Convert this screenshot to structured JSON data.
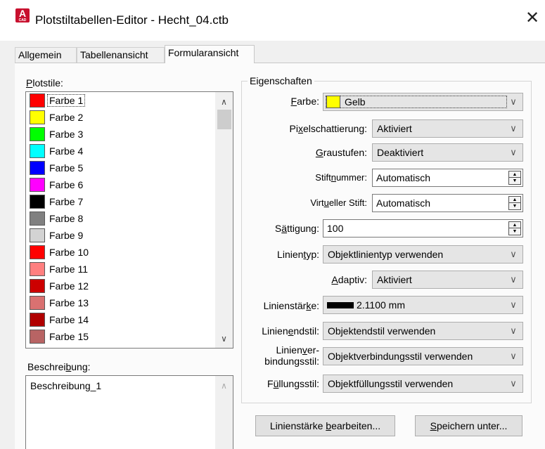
{
  "window": {
    "title": "Plotstiltabellen-Editor - Hecht_04.ctb",
    "app_icon_letter": "A",
    "app_icon_sub": "CAD",
    "close_glyph": "✕"
  },
  "tabs": [
    {
      "label": "Allgemein",
      "active": false
    },
    {
      "label": "Tabellenansicht",
      "active": false
    },
    {
      "label": "Formularansicht",
      "active": true
    }
  ],
  "plotstile": {
    "label_u": "P",
    "label_rest": "lotstile:",
    "items": [
      {
        "label": "Farbe 1",
        "color": "#ff0000",
        "selected": true
      },
      {
        "label": "Farbe 2",
        "color": "#ffff00"
      },
      {
        "label": "Farbe 3",
        "color": "#00ff00"
      },
      {
        "label": "Farbe 4",
        "color": "#00ffff"
      },
      {
        "label": "Farbe 5",
        "color": "#0000ff"
      },
      {
        "label": "Farbe 6",
        "color": "#ff00ff"
      },
      {
        "label": "Farbe 7",
        "color": "#000000"
      },
      {
        "label": "Farbe 8",
        "color": "#808080"
      },
      {
        "label": "Farbe 9",
        "color": "#d3d3d3"
      },
      {
        "label": "Farbe 10",
        "color": "#ff0000"
      },
      {
        "label": "Farbe 11",
        "color": "#ff7f7f"
      },
      {
        "label": "Farbe 12",
        "color": "#cc0000"
      },
      {
        "label": "Farbe 13",
        "color": "#d97171"
      },
      {
        "label": "Farbe 14",
        "color": "#b00000"
      },
      {
        "label": "Farbe 15",
        "color": "#b86464"
      }
    ]
  },
  "beschreibung": {
    "label_a": "Beschrei",
    "label_u": "b",
    "label_b": "ung:",
    "value": "Beschreibung_1"
  },
  "eigenschaften": {
    "title": "Eigenschaften",
    "farbe": {
      "label_u": "F",
      "label_rest": "arbe:",
      "value": "Gelb",
      "swatch": "#ffff00"
    },
    "pixel": {
      "label_a": "Pi",
      "label_u": "x",
      "label_b": "elschattierung:",
      "value": "Aktiviert"
    },
    "grau": {
      "label_u": "G",
      "label_rest": "raustufen:",
      "value": "Deaktiviert"
    },
    "stift": {
      "label_a": "Stift",
      "label_u": "n",
      "label_b": "ummer:",
      "value": "Automatisch"
    },
    "virtuell": {
      "label_a": "Virt",
      "label_u": "u",
      "label_b": "eller Stift:",
      "value": "Automatisch"
    },
    "saettigung": {
      "label_a": "S",
      "label_u": "ä",
      "label_b": "ttigung:",
      "value": "100"
    },
    "linientyp": {
      "label_a": "Linien",
      "label_u": "t",
      "label_b": "yp:",
      "value": "Objektlinientyp verwenden"
    },
    "adaptiv": {
      "label_u": "A",
      "label_rest": "daptiv:",
      "value": "Aktiviert"
    },
    "linienstaerke": {
      "label_a": "Linienstär",
      "label_u": "k",
      "label_b": "e:",
      "value": "2.1100 mm"
    },
    "linienende": {
      "label_a": "Linien",
      "label_u": "e",
      "label_b": "ndstil:",
      "value": "Objektendstil verwenden"
    },
    "linienverbindung": {
      "line1_a": "Linien",
      "line1_u": "v",
      "line1_b": "er-",
      "line2": "bindungsstil:",
      "value": "Objektverbindungsstil verwenden"
    },
    "fuellung": {
      "label_a": "F",
      "label_u": "ü",
      "label_b": "llungsstil:",
      "value": "Objektfüllungsstil verwenden"
    }
  },
  "buttons": {
    "linienstaerke": {
      "a": "Linienstärke ",
      "u": "b",
      "b": "earbeiten..."
    },
    "speichern": {
      "u": "S",
      "b": "peichern unter..."
    }
  }
}
